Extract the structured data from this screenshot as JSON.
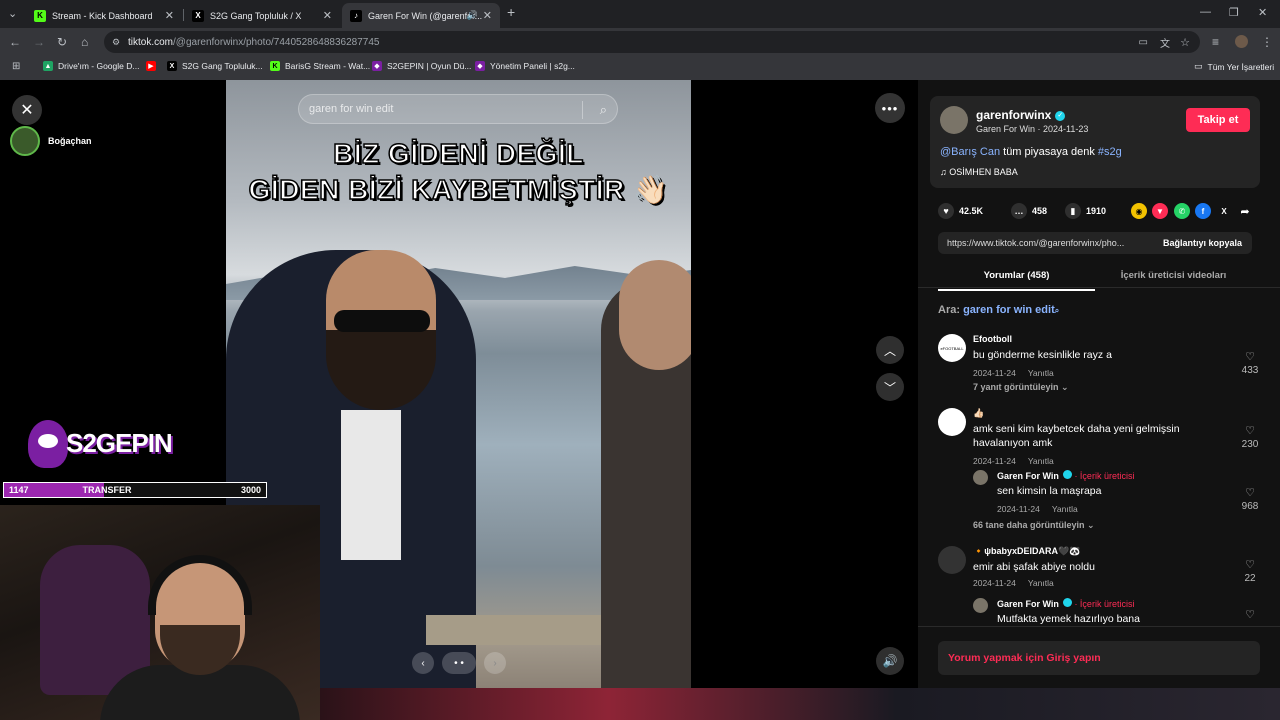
{
  "browser": {
    "tabs": [
      {
        "label": "Stream - Kick Dashboard",
        "icon": "K"
      },
      {
        "label": "S2G Gang Topluluk / X",
        "icon": "X"
      },
      {
        "label": "Garen For Win (@garenfor...",
        "icon": "♪"
      }
    ],
    "url_host": "tiktok.com",
    "url_path": "/@garenforwinx/photo/7440528648836287745",
    "bookmarks": [
      {
        "label": "Drive'ım - Google D...",
        "icon": "▲"
      },
      {
        "label": "",
        "icon": "▶"
      },
      {
        "label": "S2G Gang Topluluk...",
        "icon": "X"
      },
      {
        "label": "BarisG Stream - Wat...",
        "icon": "K"
      },
      {
        "label": "S2GEPIN | Oyun Dü...",
        "icon": "◆"
      },
      {
        "label": "Yönetim Paneli | s2g...",
        "icon": "◆"
      }
    ],
    "all_bookmarks": "Tüm Yer İşaretleri"
  },
  "viewer": {
    "search_placeholder": "garen for win edit",
    "caption_line1": "BİZ GİDENİ DEĞİL",
    "caption_line2": "GİDEN BİZİ KAYBETMİŞTİR 👋🏻"
  },
  "stream": {
    "streamer": "Boğaçhan",
    "logo_text": "S2GEPIN",
    "transfer_left": "1147",
    "transfer_label": "TRANSFER",
    "transfer_right": "3000",
    "transfer_progress": 0.38
  },
  "post": {
    "username": "garenforwinx",
    "display": "Garen For Win · 2024-11-23",
    "follow": "Takip et",
    "mention": "@Barış Can",
    "desc_mid": " tüm piyasaya denk ",
    "hashtag": "#s2g",
    "music": "♫  OSİMHEN BABA",
    "likes": "42.5K",
    "comments": "458",
    "saves": "1910",
    "link": "https://www.tiktok.com/@garenforwinx/pho...",
    "copy": "Bağlantıyı kopyala",
    "tab_comments": "Yorumlar (458)",
    "tab_creator": "İçerik üreticisi videoları",
    "search_prefix": "Ara: ",
    "search_query": "garen for win edit"
  },
  "comments": [
    {
      "name": "Efootboll",
      "avatar": "eFOOTBALL",
      "text": "bu gönderme kesinlikle rayz a",
      "date": "2024-11-24",
      "reply": "Yanıtla",
      "likes": "433",
      "more": "7 yanıt görüntüleyin"
    },
    {
      "name": "👍🏻",
      "text": "amk seni kim kaybetcek daha yeni gelmişsin havalanıyon amk",
      "date": "2024-11-24",
      "reply": "Yanıtla",
      "likes": "230"
    },
    {
      "name": "Garen For Win",
      "creator": " · İçerik üreticisi",
      "text": "sen kimsin la maşrapa",
      "date": "2024-11-24",
      "reply": "Yanıtla",
      "likes": "968",
      "more": "66 tane daha görüntüleyin"
    },
    {
      "name": "🔸ψbabyxDEIDARA🖤🐼",
      "text": "emir abi şafak abiye noldu",
      "date": "2024-11-24",
      "reply": "Yanıtla",
      "likes": "22"
    },
    {
      "name": "Garen For Win",
      "creator": " · İçerik üreticisi",
      "text": "Mutfakta yemek hazırlıyo bana"
    }
  ],
  "login": "Yorum yapmak için Giriş yapın"
}
